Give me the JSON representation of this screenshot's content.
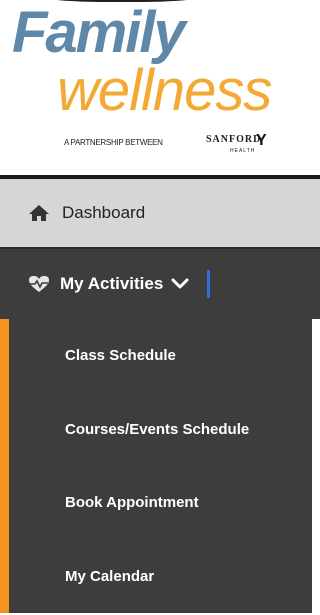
{
  "logo": {
    "word_top": "Family",
    "word_bottom": "wellness",
    "tagline": "A PARTNERSHIP BETWEEN",
    "partner": "SANFORD",
    "partner_sub": "HEALTH",
    "partner_mark": "Y"
  },
  "nav": {
    "dashboard": {
      "label": "Dashboard",
      "icon": "home-icon"
    },
    "activities": {
      "label": "My Activities",
      "icon": "heartbeat-icon",
      "chevron": "chevron-down-icon"
    },
    "submenu": [
      {
        "label": "Class Schedule"
      },
      {
        "label": "Courses/Events Schedule"
      },
      {
        "label": "Book Appointment"
      },
      {
        "label": "My Calendar"
      }
    ]
  },
  "colors": {
    "blue": "#5f87a8",
    "orange": "#f3a934",
    "accent_bar": "#f3941f",
    "nav_dark": "#3d3d3d",
    "nav_light": "#d6d6d6"
  }
}
